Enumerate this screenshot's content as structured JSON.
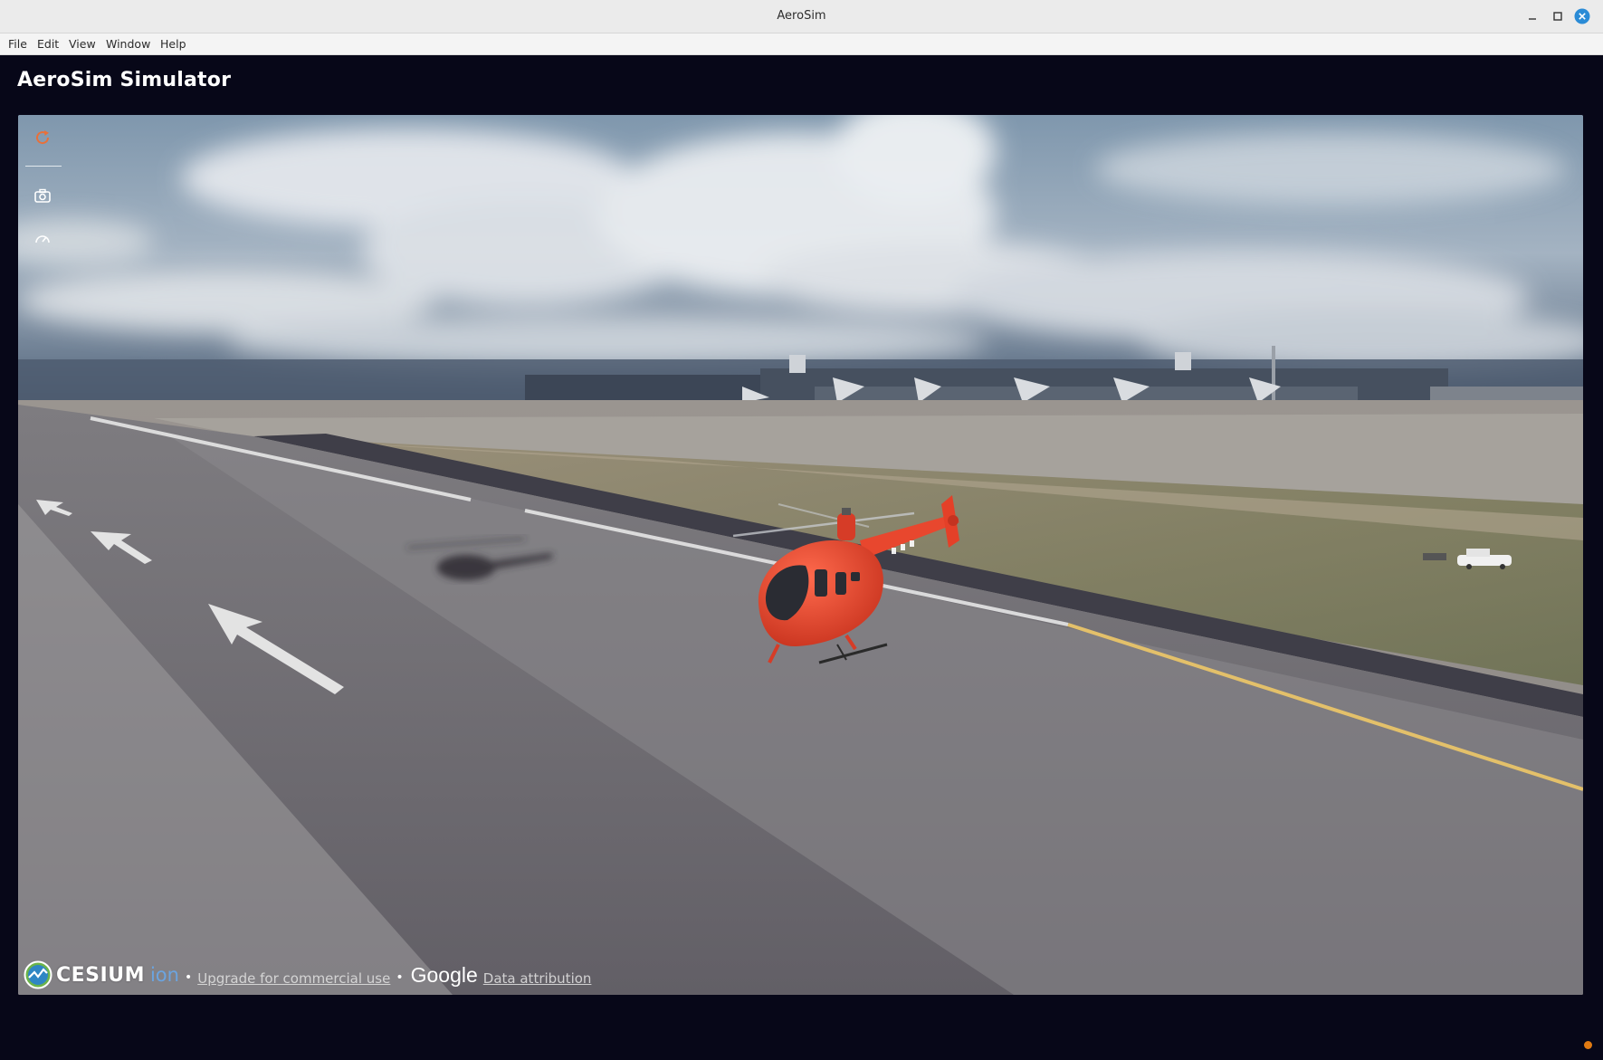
{
  "window": {
    "title": "AeroSim",
    "controls": {
      "minimize": "minimize-icon",
      "maximize": "maximize-icon",
      "close": "close-icon"
    },
    "close_color": "#2a8bd6"
  },
  "menu": {
    "items": [
      "File",
      "Edit",
      "View",
      "Window",
      "Help"
    ]
  },
  "app": {
    "title": "AeroSim Simulator",
    "background": "#070718"
  },
  "viewport_toolbar": {
    "reset_icon": "reset-view-icon",
    "camera_icon": "camera-icon",
    "gauge_icon": "gauge-icon",
    "accent": "#e8703a"
  },
  "credits": {
    "cesium": "CESIUM",
    "ion": "ion",
    "upgrade_link": "Upgrade for commercial use",
    "google": "Google",
    "data_attribution": "Data attribution"
  },
  "colors": {
    "helicopter": "#e8472e",
    "status_dot": "#e07a12"
  }
}
